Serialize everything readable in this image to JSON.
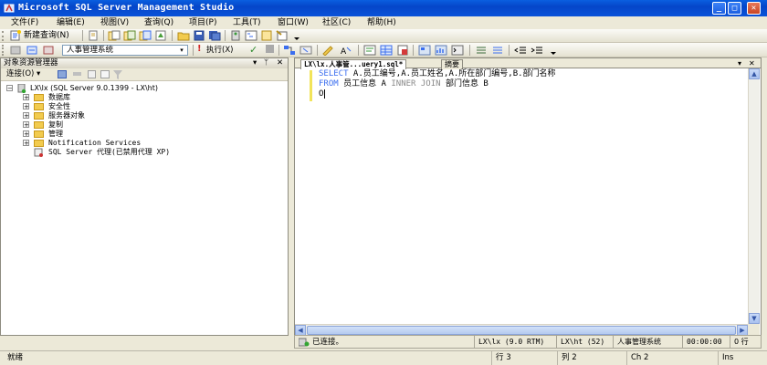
{
  "window": {
    "title": "Microsoft SQL Server Management Studio"
  },
  "menu": [
    "文件(F)",
    "编辑(E)",
    "视图(V)",
    "查询(Q)",
    "项目(P)",
    "工具(T)",
    "窗口(W)",
    "社区(C)",
    "帮助(H)"
  ],
  "toolbar": {
    "new_query": "新建查询(N)",
    "database_select": "人事管理系统",
    "execute": "执行(X)"
  },
  "object_explorer": {
    "title": "对象资源管理器",
    "connect": "连接(O) ▾",
    "server_node": "LX\\lx (SQL Server 9.0.1399 - LX\\ht)",
    "children": [
      "数据库",
      "安全性",
      "服务器对象",
      "复制",
      "管理",
      "Notification Services"
    ],
    "agent_node": "SQL Server 代理(已禁用代理 XP)"
  },
  "editor": {
    "tab_active": "LX\\lx.人事管...uery1.sql*",
    "tab_summary": "摘要",
    "code": {
      "line1_kw": "SELECT",
      "line1_rest": " A.员工编号,A.员工姓名,A.所在部门编号,B.部门名称",
      "line2_kw": "FROM",
      "line2_a": " 员工信息 A ",
      "line2_join": "INNER JOIN",
      "line2_b": " 部门信息 B",
      "line3": "O"
    }
  },
  "query_status": {
    "connected": "已连接。",
    "server": "LX\\lx (9.0 RTM)",
    "user": "LX\\ht (52)",
    "database": "人事管理系统",
    "time": "00:00:00",
    "rows": "0 行"
  },
  "statusbar": {
    "ready": "就绪",
    "line": "行 3",
    "col": "列 2",
    "ch": "Ch 2",
    "ins": "Ins"
  },
  "colors": {
    "titlebar": "#0A53D9",
    "keyword": "#3B6EEF",
    "chrome": "#ECE9D8"
  }
}
